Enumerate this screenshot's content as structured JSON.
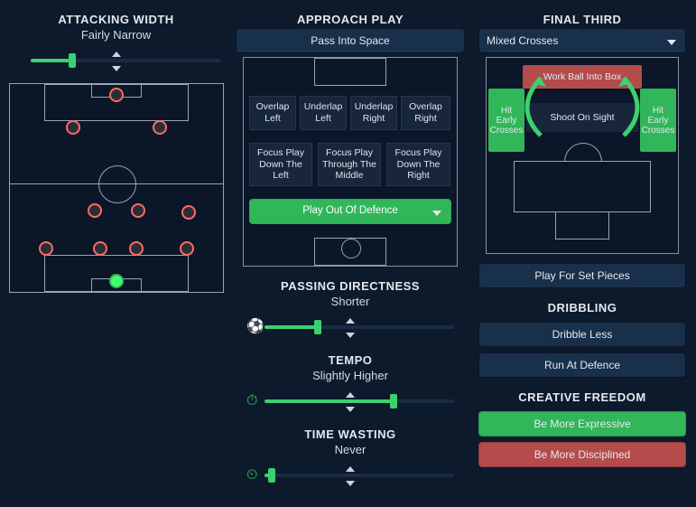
{
  "attacking_width": {
    "title": "ATTACKING WIDTH",
    "value_label": "Fairly Narrow",
    "slider_pct": 22
  },
  "approach": {
    "title": "APPROACH PLAY",
    "top_button": "Pass Into Space",
    "cells": {
      "ovl": "Overlap Left",
      "unl": "Underlap Left",
      "unr": "Underlap Right",
      "ovr": "Overlap Right",
      "fpl": "Focus Play Down The Left",
      "fpm": "Focus Play Through The Middle",
      "fpr": "Focus Play Down The Right",
      "pod": "Play Out Of Defence"
    },
    "selected": "pod"
  },
  "passing": {
    "title": "PASSING DIRECTNESS",
    "value_label": "Shorter",
    "slider_pct": 28,
    "icon": "⚽"
  },
  "tempo": {
    "title": "TEMPO",
    "value_label": "Slightly Higher",
    "slider_pct": 68,
    "icon": "⏱"
  },
  "timewaste": {
    "title": "TIME WASTING",
    "value_label": "Never",
    "slider_pct": 4,
    "icon": "⏲"
  },
  "final_third": {
    "title": "FINAL THIRD",
    "select": "Mixed Crosses",
    "work_ball": "Work Ball Into Box",
    "hit_early_l": "Hit Early Crosses",
    "hit_early_r": "Hit Early Crosses",
    "shoot": "Shoot On Sight",
    "set_pieces": "Play For Set Pieces"
  },
  "dribbling": {
    "title": "DRIBBLING",
    "less": "Dribble Less",
    "run": "Run At Defence"
  },
  "creative": {
    "title": "CREATIVE FREEDOM",
    "expr": "Be More Expressive",
    "disc": "Be More Disciplined"
  }
}
